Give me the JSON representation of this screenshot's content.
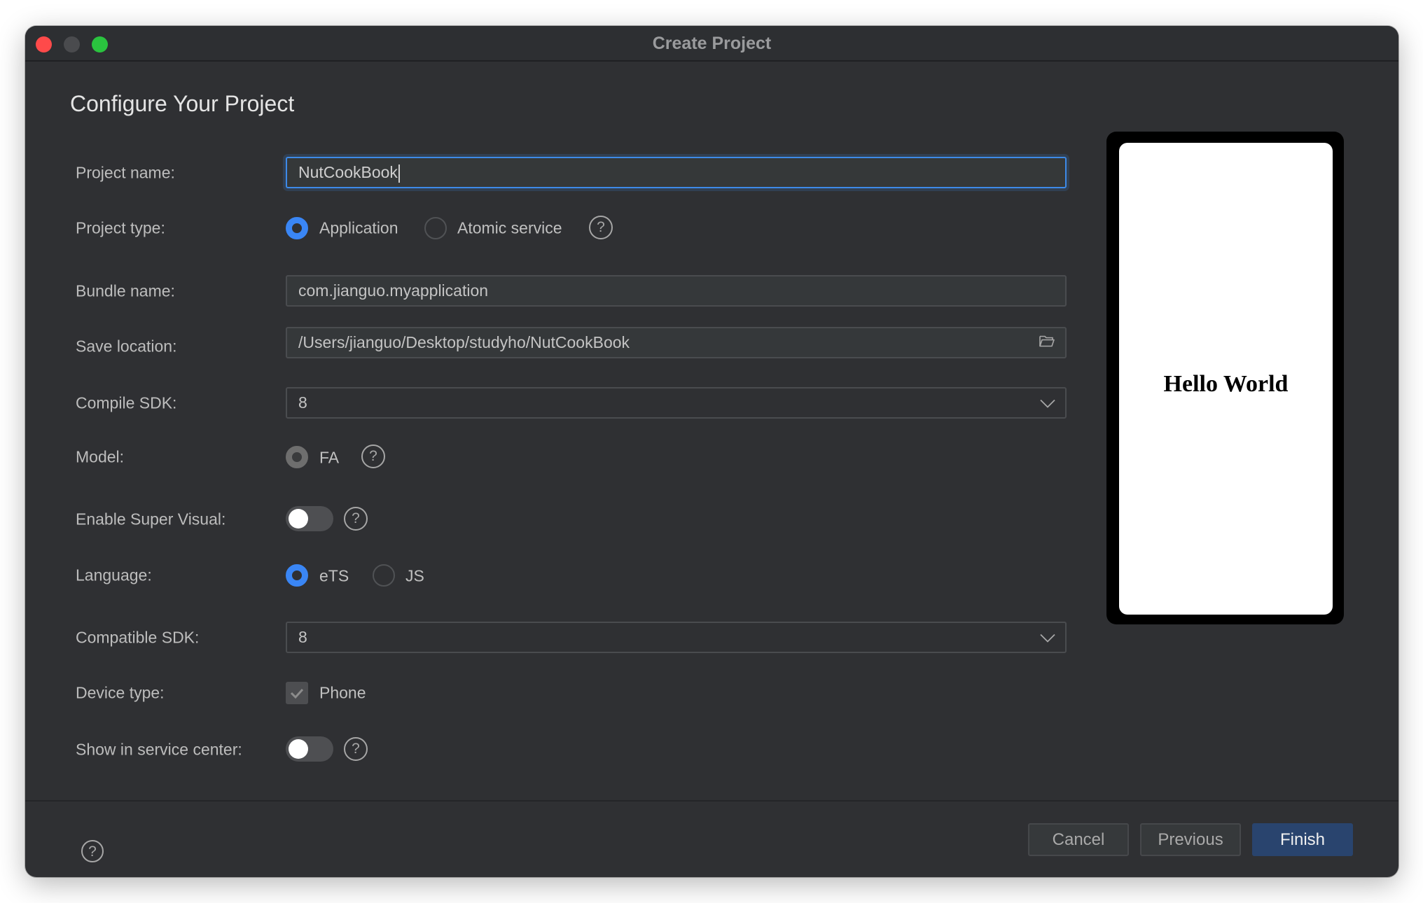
{
  "window": {
    "title": "Create Project",
    "controls": [
      "close",
      "minimize",
      "maximize"
    ]
  },
  "heading": "Configure Your Project",
  "form": {
    "project_name": {
      "label": "Project name:",
      "value": "NutCookBook"
    },
    "project_type": {
      "label": "Project type:",
      "options": [
        {
          "label": "Application",
          "selected": true
        },
        {
          "label": "Atomic service",
          "selected": false
        }
      ],
      "help_icon": "question-circle-icon"
    },
    "bundle_name": {
      "label": "Bundle name:",
      "value": "com.jianguo.myapplication"
    },
    "save_location": {
      "label": "Save location:",
      "value": "/Users/jianguo/Desktop/studyho/NutCookBook",
      "icon": "folder-open-icon"
    },
    "compile_sdk": {
      "label": "Compile SDK:",
      "value": "8",
      "icon": "chevron-down-icon"
    },
    "model": {
      "label": "Model:",
      "options": [
        {
          "label": "FA",
          "selected": true,
          "disabled": true
        }
      ],
      "help_icon": "question-circle-icon"
    },
    "enable_super_visual": {
      "label": "Enable Super Visual:",
      "on": false,
      "help_icon": "question-circle-icon"
    },
    "language": {
      "label": "Language:",
      "options": [
        {
          "label": "eTS",
          "selected": true
        },
        {
          "label": "JS",
          "selected": false
        }
      ]
    },
    "compatible_sdk": {
      "label": "Compatible SDK:",
      "value": "8",
      "icon": "chevron-down-icon"
    },
    "device_type": {
      "label": "Device type:",
      "option": "Phone",
      "checked": true
    },
    "show_in_service_center": {
      "label": "Show in service center:",
      "on": false,
      "help_icon": "question-circle-icon"
    }
  },
  "preview": {
    "text": "Hello World"
  },
  "footer": {
    "help_icon": "question-circle-icon",
    "cancel_label": "Cancel",
    "previous_label": "Previous",
    "finish_label": "Finish"
  },
  "colors": {
    "accent": "#3a86f5",
    "primary_button": "#29446e",
    "window_bg": "#2f3033",
    "focus_border": "#3d8ae8"
  },
  "help_glyph": "?"
}
